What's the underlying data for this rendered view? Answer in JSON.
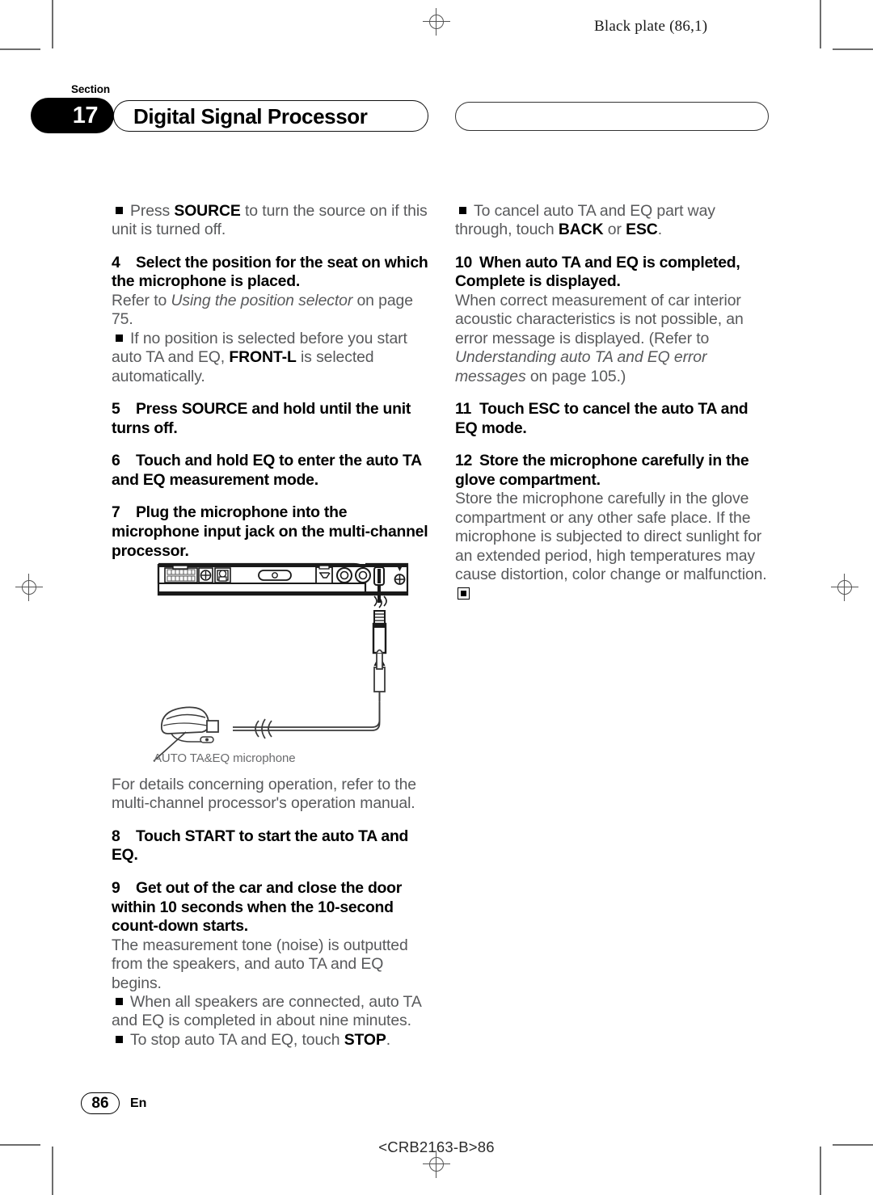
{
  "page": {
    "plate_label": "Black plate (86,1)",
    "section_word": "Section",
    "section_number": "17",
    "section_title": "Digital Signal Processor",
    "page_number": "86",
    "language_code": "En",
    "part_number": "<CRB2163-B>86"
  },
  "left_column": {
    "note_1": {
      "bullet": "■",
      "text_a": "Press ",
      "bold_a": "SOURCE",
      "text_b": " to turn the source on if this unit is turned off."
    },
    "step_4": {
      "number": "4",
      "title": "Select the position for the seat on which the microphone is placed.",
      "body_a": "Refer to ",
      "body_italic": "Using the position selector",
      "body_b": " on page 75."
    },
    "note_2": {
      "bullet": "■",
      "text_a": "If no position is selected before you start auto TA and EQ, ",
      "bold_a": "FRONT-L",
      "text_b": " is selected automatically."
    },
    "step_5": {
      "number": "5",
      "title": "Press SOURCE and hold until the unit turns off."
    },
    "step_6": {
      "number": "6",
      "title": "Touch and hold EQ to enter the auto TA and EQ measurement mode."
    },
    "step_7": {
      "number": "7",
      "title": "Plug the microphone into the microphone input jack on the multi-channel processor."
    },
    "figure_caption": "AUTO TA&EQ microphone",
    "after_figure": "For details concerning operation, refer to the multi-channel processor's operation manual.",
    "step_8": {
      "number": "8",
      "title": "Touch START to start the auto TA and EQ."
    },
    "step_9": {
      "number": "9",
      "title": "Get out of the car and close the door within 10 seconds when the 10-second count-down starts.",
      "body": "The measurement tone (noise) is outputted from the speakers, and auto TA and EQ begins."
    },
    "note_3": {
      "bullet": "■",
      "text": "When all speakers are connected, auto TA and EQ is completed in about nine minutes."
    },
    "note_4": {
      "bullet": "■",
      "text_a": "To stop auto TA and EQ, touch ",
      "bold_a": "STOP",
      "text_b": "."
    }
  },
  "right_column": {
    "note_5": {
      "bullet": "■",
      "text_a": "To cancel auto TA and EQ part way through, touch ",
      "bold_a": "BACK",
      "text_b": " or ",
      "bold_b": "ESC",
      "text_c": "."
    },
    "step_10": {
      "number": "10",
      "title": "When auto TA and EQ is completed, Complete is displayed.",
      "body_a": "When correct measurement of car interior acoustic characteristics is not possible, an error message is displayed. (Refer to ",
      "body_italic": "Understanding auto TA and EQ error messages",
      "body_b": " on page 105.)"
    },
    "step_11": {
      "number": "11",
      "title": "Touch ESC to cancel the auto TA and EQ mode."
    },
    "step_12": {
      "number": "12",
      "title": "Store the microphone carefully in the glove compartment.",
      "body": "Store the microphone carefully in the glove compartment or any other safe place. If the microphone is subjected to direct sunlight for an extended period, high temperatures may cause distortion, color change or malfunction."
    }
  },
  "figure": {
    "name": "processor-rear-panel-and-microphone",
    "parts": [
      "multi-pin-power-connector",
      "screw-terminal",
      "screw-terminal",
      "slot-connector",
      "square-connector",
      "rca-jack",
      "rca-jack",
      "microphone-input-jack",
      "ground-screw",
      "microphone-plug",
      "microphone-cable",
      "microphone-body"
    ]
  }
}
